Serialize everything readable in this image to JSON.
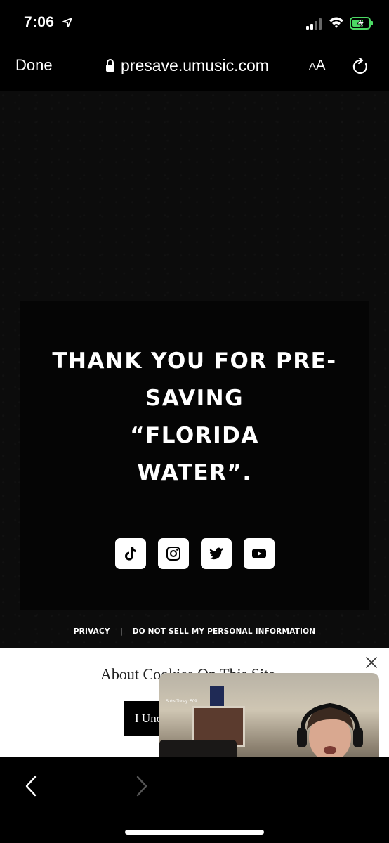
{
  "status_bar": {
    "time": "7:06",
    "icons": [
      "location-arrow-icon",
      "cellular-signal-icon",
      "wifi-icon",
      "battery-charging-icon"
    ],
    "battery_color": "#4cd964"
  },
  "browser": {
    "done_label": "Done",
    "url": "presave.umusic.com",
    "reader_label_small": "A",
    "reader_label_large": "A",
    "icons": [
      "lock-icon",
      "reload-icon",
      "back-chevron-icon",
      "forward-chevron-icon"
    ]
  },
  "page": {
    "heading_lines": [
      "THANK YOU FOR PRE-",
      "SAVING",
      "“FLORIDA",
      "WATER”."
    ],
    "social_icons": [
      "tiktok-icon",
      "instagram-icon",
      "twitter-icon",
      "youtube-icon"
    ],
    "footer": {
      "privacy": "PRIVACY",
      "separator": "|",
      "do_not_sell": "DO NOT SELL MY PERSONAL INFORMATION"
    },
    "background_color": "#0c0c0c"
  },
  "cookie_banner": {
    "title": "About Cookies On This Site",
    "button_label": "I Understand"
  },
  "pip_video": {
    "caption": "Subs Today: 509"
  }
}
